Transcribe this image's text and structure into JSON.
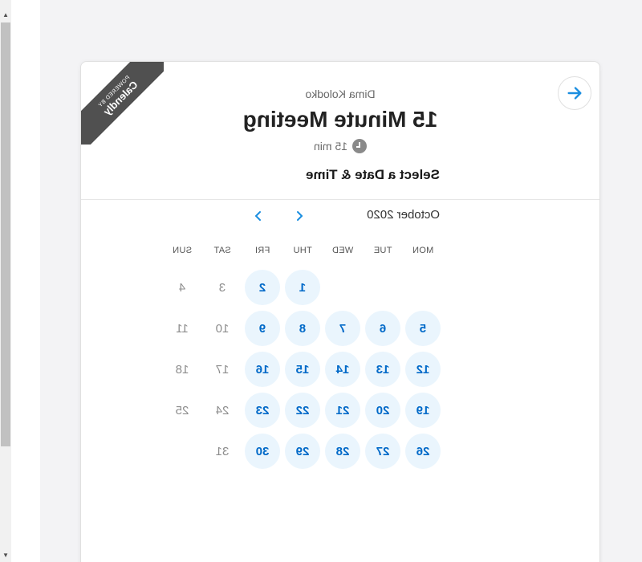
{
  "header": {
    "host": "Dima Kolodko",
    "title": "15 Minute Meeting",
    "duration": "15 min",
    "ribbon_small": "POWERED BY",
    "ribbon_big": "Calendly"
  },
  "calendar": {
    "heading": "Select a Date & Time",
    "month": "October 2020",
    "weekdays": [
      "MON",
      "TUE",
      "WED",
      "THU",
      "FRI",
      "SAT",
      "SUN"
    ],
    "weeks": [
      [
        null,
        null,
        null,
        {
          "d": "1",
          "a": true
        },
        {
          "d": "2",
          "a": true
        },
        {
          "d": "3",
          "a": false
        },
        {
          "d": "4",
          "a": false
        }
      ],
      [
        {
          "d": "5",
          "a": true
        },
        {
          "d": "6",
          "a": true
        },
        {
          "d": "7",
          "a": true
        },
        {
          "d": "8",
          "a": true
        },
        {
          "d": "9",
          "a": true
        },
        {
          "d": "10",
          "a": false
        },
        {
          "d": "11",
          "a": false
        }
      ],
      [
        {
          "d": "12",
          "a": true
        },
        {
          "d": "13",
          "a": true
        },
        {
          "d": "14",
          "a": true
        },
        {
          "d": "15",
          "a": true
        },
        {
          "d": "16",
          "a": true
        },
        {
          "d": "17",
          "a": false
        },
        {
          "d": "18",
          "a": false
        }
      ],
      [
        {
          "d": "19",
          "a": true
        },
        {
          "d": "20",
          "a": true
        },
        {
          "d": "21",
          "a": true
        },
        {
          "d": "22",
          "a": true
        },
        {
          "d": "23",
          "a": true
        },
        {
          "d": "24",
          "a": false
        },
        {
          "d": "25",
          "a": false
        }
      ],
      [
        {
          "d": "26",
          "a": true
        },
        {
          "d": "27",
          "a": true
        },
        {
          "d": "28",
          "a": true
        },
        {
          "d": "29",
          "a": true
        },
        {
          "d": "30",
          "a": true
        },
        {
          "d": "31",
          "a": false
        },
        null
      ]
    ]
  },
  "icons": {
    "back": "arrow-left-icon",
    "prev": "chevron-left-icon",
    "next": "chevron-right-icon",
    "clock": "clock-icon"
  },
  "colors": {
    "accent": "#0069c8",
    "available_bg": "#eaf5fd",
    "ribbon": "#505050"
  }
}
